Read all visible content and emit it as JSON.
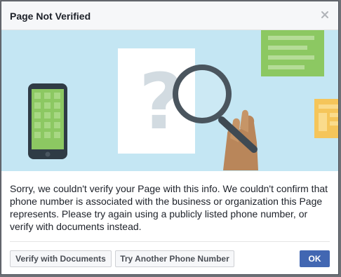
{
  "dialog": {
    "title": "Page Not Verified",
    "message": "Sorry, we couldn't verify your Page with this info. We couldn't confirm that phone number is associated with the business or organization this Page represents. Please try again using a publicly listed phone number, or verify with documents instead.",
    "buttons": {
      "verify_documents": "Verify with Documents",
      "try_another_phone": "Try Another Phone Number",
      "ok": "OK"
    }
  },
  "colors": {
    "header_bg": "#f6f7f9",
    "illustration_bg": "#c4e6f3",
    "primary_button": "#4267b2",
    "text": "#1d2129"
  },
  "icons": {
    "close": "close-icon",
    "illustration": "verification-illustration"
  }
}
